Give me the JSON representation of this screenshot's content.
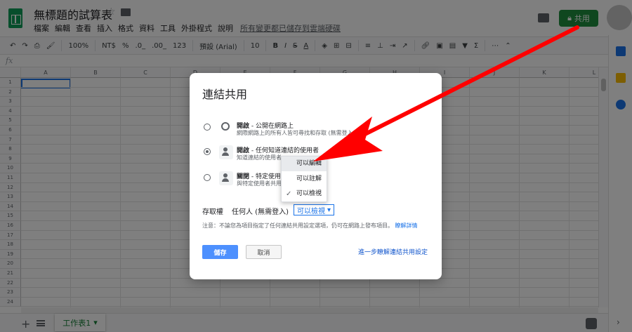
{
  "header": {
    "doc_title": "無標題的試算表",
    "menus": [
      "檔案",
      "編輯",
      "查看",
      "插入",
      "格式",
      "資料",
      "工具",
      "外掛程式",
      "說明"
    ],
    "saved_status": "所有變更都已儲存到雲端硬碟",
    "share_label": "共用"
  },
  "toolbar": {
    "zoom": "100%",
    "currency": "NT$",
    "percent": "%",
    "decimal_less": ".0_",
    "decimal_more": ".00_",
    "more_formats": "123",
    "font": "預設 (Arial)",
    "font_size": "10",
    "bold": "B",
    "italic": "I",
    "strike": "S",
    "text_color": "A",
    "more": "⋯"
  },
  "formula": {
    "fx": "fx"
  },
  "grid": {
    "columns": [
      "A",
      "B",
      "C",
      "D",
      "E",
      "F",
      "G",
      "H",
      "I",
      "J",
      "K",
      "L"
    ],
    "rows": [
      "1",
      "2",
      "3",
      "4",
      "5",
      "6",
      "7",
      "8",
      "9",
      "10",
      "11",
      "12",
      "13",
      "14",
      "15",
      "16",
      "17",
      "18",
      "19",
      "20",
      "21",
      "22",
      "23",
      "24"
    ]
  },
  "sheets": {
    "tab_label": "工作表1",
    "add_label": "+"
  },
  "dialog": {
    "title": "連結共用",
    "options": [
      {
        "title_bold": "開啟",
        "title_rest": " - 公開在網路上",
        "desc": "網際網路上的所有人皆可尋找和存取 (無需登入)。",
        "selected": false,
        "icon": "globe-icon"
      },
      {
        "title_bold": "開啟",
        "title_rest": " - 任何知道連結的使用者",
        "desc": "知道連結的使用者",
        "selected": true,
        "icon": "person-link-icon"
      },
      {
        "title_bold": "關閉",
        "title_rest": " - 特定使用",
        "desc": "與特定使用者共用",
        "selected": false,
        "icon": "person-icon"
      }
    ],
    "access_label": "存取權",
    "access_who": "任何人 (無需登入)",
    "access_value": "可以檢視",
    "note_text": "注意：不論您為項目指定了任何連結共用設定選項，仍可在網路上發布項目。",
    "note_link": "瞭解詳情",
    "save_label": "儲存",
    "cancel_label": "取消",
    "learn_more": "進一步瞭解連結共用設定"
  },
  "dropdown": {
    "items": [
      {
        "label": "可以編輯",
        "highlighted": true,
        "checked": false
      },
      {
        "label": "可以註解",
        "highlighted": false,
        "checked": false
      },
      {
        "label": "可以檢視",
        "highlighted": false,
        "checked": true
      }
    ],
    "check_glyph": "✓"
  },
  "colors": {
    "share_green": "#1e8e3e",
    "annotation_arrow": "#ff0000",
    "link_blue": "#1a73e8",
    "save_blue": "#4d90fe"
  }
}
